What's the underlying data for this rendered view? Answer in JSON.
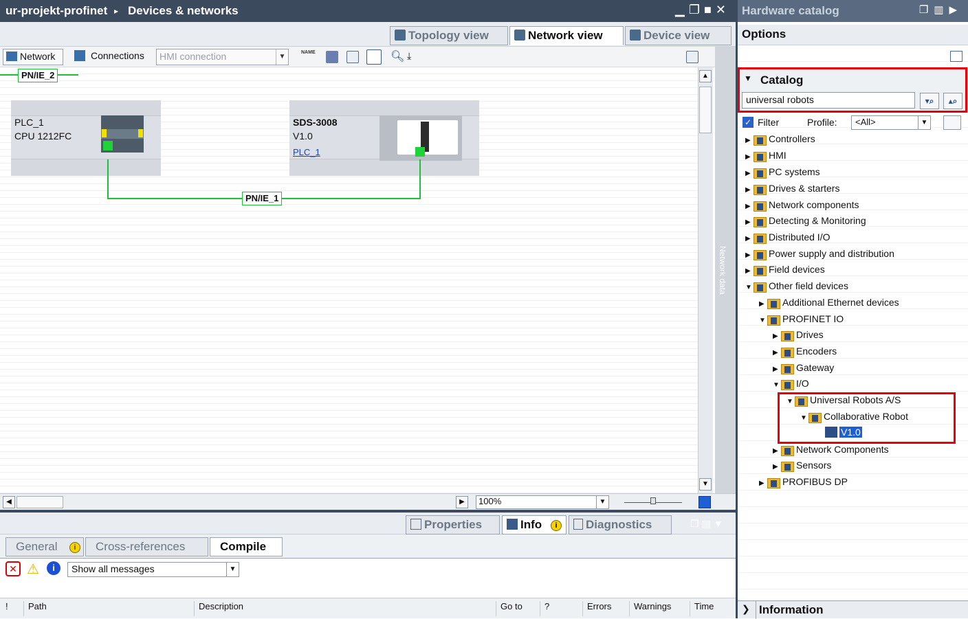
{
  "titlebar": {
    "project": "ur-projekt-profinet",
    "separator": "▸",
    "editor": "Devices & networks"
  },
  "views": {
    "topology": "Topology view",
    "network": "Network view",
    "device": "Device view"
  },
  "toolbar": {
    "network": "Network",
    "connections": "Connections",
    "connection_type": "HMI connection",
    "name_icon": "NAME"
  },
  "subnet_top": "PN/IE_2",
  "subnet_main": "PN/IE_1",
  "devices": [
    {
      "name": "PLC_1",
      "type": "CPU 1212FC"
    },
    {
      "name": "SDS-3008",
      "type": "V1.0",
      "link": "PLC_1"
    }
  ],
  "network_data_label": "Network data",
  "zoom": "100%",
  "inspector": {
    "tabs": {
      "properties": "Properties",
      "info": "Info",
      "diagnostics": "Diagnostics"
    },
    "subtabs": {
      "general": "General",
      "crossref": "Cross-references",
      "compile": "Compile"
    },
    "filter": "Show all messages",
    "columns": {
      "bang": "!",
      "path": "Path",
      "description": "Description",
      "goto": "Go to",
      "q": "?",
      "errors": "Errors",
      "warnings": "Warnings",
      "time": "Time"
    }
  },
  "hw": {
    "title": "Hardware catalog",
    "options": "Options",
    "catalog": "Catalog",
    "search": "universal robots",
    "filter_label": "Filter",
    "profile_label": "Profile:",
    "profile_value": "<All>",
    "information": "Information",
    "tree": [
      {
        "label": "Controllers"
      },
      {
        "label": "HMI"
      },
      {
        "label": "PC systems"
      },
      {
        "label": "Drives & starters"
      },
      {
        "label": "Network components"
      },
      {
        "label": "Detecting & Monitoring"
      },
      {
        "label": "Distributed I/O"
      },
      {
        "label": "Power supply and distribution"
      },
      {
        "label": "Field devices"
      },
      {
        "label": "Other field devices"
      },
      {
        "label": "Additional Ethernet devices"
      },
      {
        "label": "PROFINET IO"
      },
      {
        "label": "Drives"
      },
      {
        "label": "Encoders"
      },
      {
        "label": "Gateway"
      },
      {
        "label": "I/O"
      },
      {
        "label": "Universal Robots A/S"
      },
      {
        "label": "Collaborative Robot"
      },
      {
        "label": "V1.0"
      },
      {
        "label": "Network Components"
      },
      {
        "label": "Sensors"
      },
      {
        "label": "PROFIBUS DP"
      }
    ]
  },
  "colors": {
    "title_bar": "#3b4a5c",
    "subnet_green": "#1fbf3a",
    "highlight_red": "#e8000b",
    "selection_blue": "#1f5fd6"
  }
}
